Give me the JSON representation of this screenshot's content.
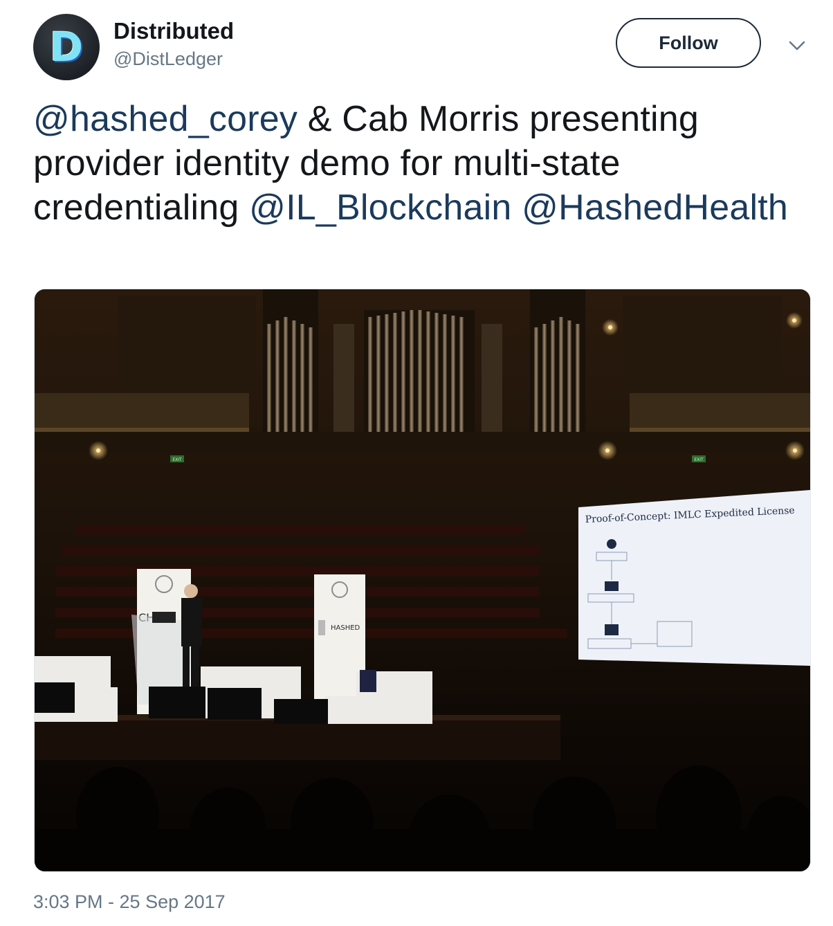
{
  "tweet": {
    "author": {
      "name": "Distributed",
      "handle": "@DistLedger",
      "avatar_letter": "D"
    },
    "follow_label": "Follow",
    "text": {
      "mention_1": "@hashed_corey",
      "part_1": " & Cab Morris presenting provider identity demo for multi-state credentialing ",
      "mention_2": "@IL_Blockchain",
      "mention_3": "@HashedHealth"
    },
    "media": {
      "slide_title": "Proof-of-Concept: IMLC Expedited License",
      "banner_left_word": "CH",
      "banner_right_word": "HASHED",
      "exit_sign": "EXIT"
    },
    "timestamp": "3:03 PM - 25 Sep 2017"
  },
  "colors": {
    "text": "#14171a",
    "secondary": "#657786",
    "mention": "#1b3a5c",
    "follow_border": "#1c2938"
  }
}
